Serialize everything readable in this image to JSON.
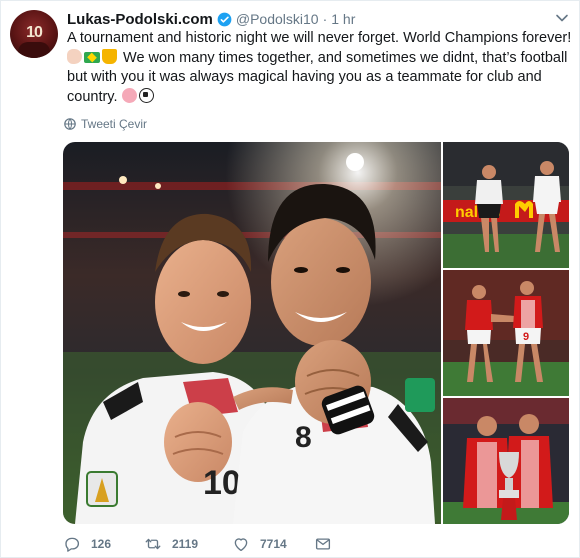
{
  "tweet": {
    "author": {
      "display_name": "Lukas-Podolski.com",
      "handle": "@Podolski10",
      "verified": true,
      "avatar_jersey_number": "10"
    },
    "separator": "·",
    "time": "1 hr",
    "text_lines": [
      "A tournament and historic night we will never forget. World Champions forever!",
      "We won many times together, and sometimes we didnt, that’s football",
      "but with you it was always magical having you as a teammate for club and",
      "country."
    ],
    "emojis": {
      "line2": [
        "muscle-emoji",
        "brazil-flag-emoji",
        "trophy-emoji"
      ],
      "line4": [
        "brain-emoji",
        "soccer-ball-emoji"
      ]
    },
    "translate_label": "Tweeti Çevir",
    "media": {
      "main_photo": {
        "jersey_left_number": "10",
        "jersey_right_number": "8"
      },
      "side_photos": [
        {
          "banner_text": "nald's"
        },
        {
          "jersey_number": "9"
        },
        {}
      ]
    },
    "actions": {
      "reply_count": "126",
      "retweet_count": "2119",
      "like_count": "7714"
    },
    "colors": {
      "verified_blue": "#1da1f2",
      "secondary_text": "#657786",
      "primary_text": "#14171a"
    }
  }
}
